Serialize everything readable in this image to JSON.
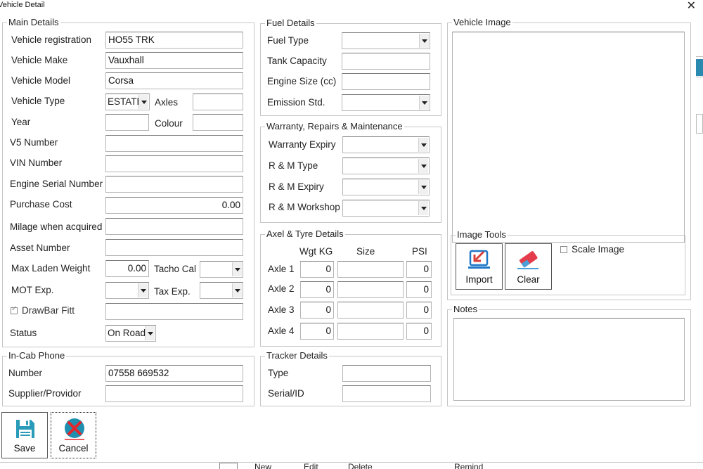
{
  "window": {
    "title": "Vehicle Detail",
    "close_label": "✕"
  },
  "main_details": {
    "legend": "Main Details",
    "registration": {
      "label": "Vehicle registration",
      "value": "HO55 TRK"
    },
    "make": {
      "label": "Vehicle Make",
      "value": "Vauxhall"
    },
    "model": {
      "label": "Vehicle Model",
      "value": "Corsa"
    },
    "type": {
      "label": "Vehicle Type",
      "value": "ESTATE"
    },
    "axles": {
      "label": "Axles",
      "value": ""
    },
    "year": {
      "label": "Year",
      "value": ""
    },
    "colour": {
      "label": "Colour",
      "value": ""
    },
    "v5": {
      "label": "V5 Number",
      "value": ""
    },
    "vin": {
      "label": "VIN Number",
      "value": ""
    },
    "engine_serial": {
      "label": "Engine Serial Number",
      "value": ""
    },
    "purchase_cost": {
      "label": "Purchase Cost",
      "value": "0.00"
    },
    "milage": {
      "label": "Milage when acquired",
      "value": ""
    },
    "asset": {
      "label": "Asset Number",
      "value": ""
    },
    "max_laden": {
      "label": "Max Laden Weight",
      "value": "0.00"
    },
    "tacho": {
      "label": "Tacho Cal",
      "value": ""
    },
    "mot": {
      "label": "MOT Exp.",
      "value": ""
    },
    "tax": {
      "label": "Tax Exp.",
      "value": ""
    },
    "drawbar": {
      "label": "DrawBar Fitt",
      "checked": true,
      "value": ""
    },
    "status": {
      "label": "Status",
      "value": "On Road"
    }
  },
  "in_cab_phone": {
    "legend": "In-Cab Phone",
    "number": {
      "label": "Number",
      "value": "07558 669532"
    },
    "supplier": {
      "label": "Supplier/Providor",
      "value": ""
    }
  },
  "fuel_details": {
    "legend": "Fuel Details",
    "fuel_type": {
      "label": "Fuel Type",
      "value": ""
    },
    "tank": {
      "label": "Tank Capacity",
      "value": ""
    },
    "engine_size": {
      "label": "Engine Size (cc)",
      "value": ""
    },
    "emission": {
      "label": "Emission Std.",
      "value": ""
    }
  },
  "warranty": {
    "legend": "Warranty, Repairs & Maintenance",
    "warranty_expiry": {
      "label": "Warranty Expiry",
      "value": ""
    },
    "rm_type": {
      "label": "R & M Type",
      "value": ""
    },
    "rm_expiry": {
      "label": "R & M Expiry",
      "value": ""
    },
    "rm_workshop": {
      "label": "R & M Workshop",
      "value": ""
    }
  },
  "axel_tyre": {
    "legend": "Axel & Tyre Details",
    "headers": {
      "wgt": "Wgt KG",
      "size": "Size",
      "psi": "PSI"
    },
    "rows": [
      {
        "label": "Axle 1",
        "wgt": "0",
        "size": "",
        "psi": "0"
      },
      {
        "label": "Axle 2",
        "wgt": "0",
        "size": "",
        "psi": "0"
      },
      {
        "label": "Axle 3",
        "wgt": "0",
        "size": "",
        "psi": "0"
      },
      {
        "label": "Axle 4",
        "wgt": "0",
        "size": "",
        "psi": "0"
      }
    ]
  },
  "tracker": {
    "legend": "Tracker Details",
    "type": {
      "label": "Type",
      "value": ""
    },
    "serial": {
      "label": "Serial/ID",
      "value": ""
    }
  },
  "vehicle_image": {
    "legend": "Vehicle Image",
    "tools_legend": "Image Tools",
    "import_label": "Import",
    "clear_label": "Clear",
    "scale_label": "Scale Image",
    "scale_checked": false
  },
  "notes": {
    "legend": "Notes",
    "value": ""
  },
  "actions": {
    "save_label": "Save",
    "cancel_label": "Cancel"
  },
  "background_toolbar": {
    "new": "New",
    "edit": "Edit",
    "delete": "Delete",
    "remind": "Remind"
  },
  "colors": {
    "save_icon": "#2a9bb8",
    "cancel_icon": "#1f8fb0",
    "cancel_x": "#e2262b",
    "import_icon": "#1f77c8",
    "import_arrow": "#d8403a",
    "clear_icon": "#e43c4a"
  }
}
